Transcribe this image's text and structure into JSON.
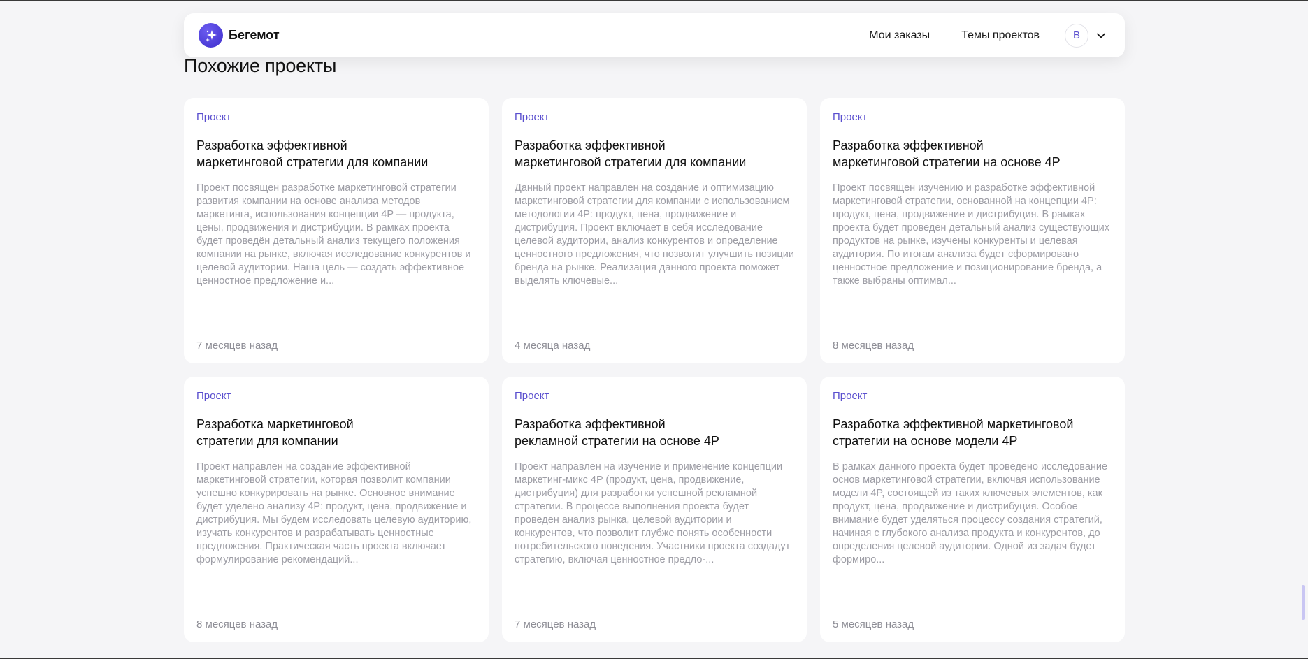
{
  "header": {
    "brand": "Бегемот",
    "logo_icon": "sparkle-icon",
    "nav": [
      "Мои заказы",
      "Темы проектов"
    ],
    "avatar_initial": "В",
    "chevron_icon": "chevron-down-icon",
    "accent_color": "#5a4fcf"
  },
  "section": {
    "title": "Похожие проекты"
  },
  "cards": [
    {
      "type": "Проект",
      "title_line1": "Разработка эффективной",
      "title_line2": "маркетинговой стратегии для компании",
      "description": "Проект посвящен разработке маркетинговой стратегии развития компании на основе анализа методов маркетинга, использования концепции 4P — продукта, цены, продвижения и дистрибуции. В рамках проекта будет проведён детальный анализ текущего положения компании на рынке, включая исследование конкурентов и целевой аудитории. Наша цель — создать эффективное ценностное предложение и...",
      "time": "7 месяцев назад"
    },
    {
      "type": "Проект",
      "title_line1": "Разработка эффективной",
      "title_line2": "маркетинговой стратегии для компании",
      "description": "Данный проект направлен на создание и оптимизацию маркетинговой стратегии для компании с использованием методологии 4P: продукт, цена, продвижение и дистрибуция. Проект включает в себя исследование целевой аудитории, анализ конкурентов и определение ценностного предложения, что позволит улучшить позиции бренда на рынке. Реализация данного проекта поможет выделять ключевые...",
      "time": "4 месяца назад"
    },
    {
      "type": "Проект",
      "title_line1": "Разработка эффективной",
      "title_line2": "маркетинговой стратегии на основе 4P",
      "description": "Проект посвящен изучению и разработке эффективной маркетинговой стратегии, основанной на концепции 4P: продукт, цена, продвижение и дистрибуция. В рамках проекта будет проведен детальный анализ существующих продуктов на рынке, изучены конкуренты и целевая аудитория. По итогам анализа будет сформировано ценностное предложение и позиционирование бренда, а также выбраны оптимал...",
      "time": "8 месяцев назад"
    },
    {
      "type": "Проект",
      "title_line1": "Разработка маркетинговой",
      "title_line2": "стратегии для компании",
      "description": "Проект направлен на создание эффективной маркетинговой стратегии, которая позволит компании успешно конкурировать на рынке. Основное внимание будет уделено анализу 4P: продукт, цена, продвижение и дистрибуция. Мы будем исследовать целевую аудиторию, изучать конкурентов и разрабатывать ценностные предложения. Практическая часть проекта включает формулирование рекомендаций...",
      "time": "8 месяцев назад"
    },
    {
      "type": "Проект",
      "title_line1": "Разработка эффективной",
      "title_line2": "рекламной стратегии на основе 4P",
      "description": "Проект направлен на изучение и применение концепции маркетинг-микс 4P (продукт, цена, продвижение, дистрибуция) для разработки успешной рекламной стратегии. В процессе выполнения проекта будет проведен анализ рынка, целевой аудитории и конкурентов, что позволит глубже понять особенности потребительского поведения. Участники проекта создадут стратегию, включая ценностное предло-...",
      "time": "7 месяцев назад"
    },
    {
      "type": "Проект",
      "title_line1": "Разработка эффективной маркетинговой",
      "title_line2": "стратегии на основе модели 4P",
      "description": "В рамках данного проекта будет проведено исследование основ маркетинговой стратегии, включая использование модели 4P, состоящей из таких ключевых элементов, как продукт, цена, продвижение и дистрибуция. Особое внимание будет уделяться процессу создания стратегий, начиная с глубокого анализа продукта и конкурентов, до определения целевой аудитории. Одной из задач будет формиро...",
      "time": "5 месяцев назад"
    }
  ]
}
